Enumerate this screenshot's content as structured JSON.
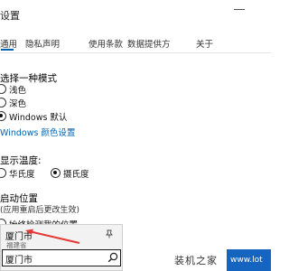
{
  "window": {
    "title": "设置"
  },
  "tabs": [
    {
      "label": "通用"
    },
    {
      "label": "隐私声明"
    },
    {
      "label": "使用条款"
    },
    {
      "label": "数据提供方"
    },
    {
      "label": "关于"
    }
  ],
  "mode_section": {
    "title": "选择一种模式",
    "options": [
      {
        "label": "浅色",
        "checked": false
      },
      {
        "label": "深色",
        "checked": false
      },
      {
        "label": "Windows 默认",
        "checked": true
      }
    ],
    "link": "Windows 颜色设置"
  },
  "temp_section": {
    "title": "显示温度:",
    "options": [
      {
        "label": "华氏度",
        "checked": false
      },
      {
        "label": "摄氏度",
        "checked": true
      }
    ]
  },
  "location_section": {
    "title": "启动位置",
    "note": "(应用重启后更改生效)",
    "option": {
      "label": "始终检测我的位置",
      "checked": false
    }
  },
  "suggestion": {
    "city": "厦门市",
    "region": "福建省",
    "pin_icon": "pin-icon"
  },
  "search": {
    "value": "厦门市",
    "icon": "search-icon"
  },
  "watermark": {
    "text": "装机之家",
    "badge": "www.lot"
  },
  "colors": {
    "accent": "#0063b1",
    "arrow": "#e53935",
    "badge": "#1565c0"
  }
}
